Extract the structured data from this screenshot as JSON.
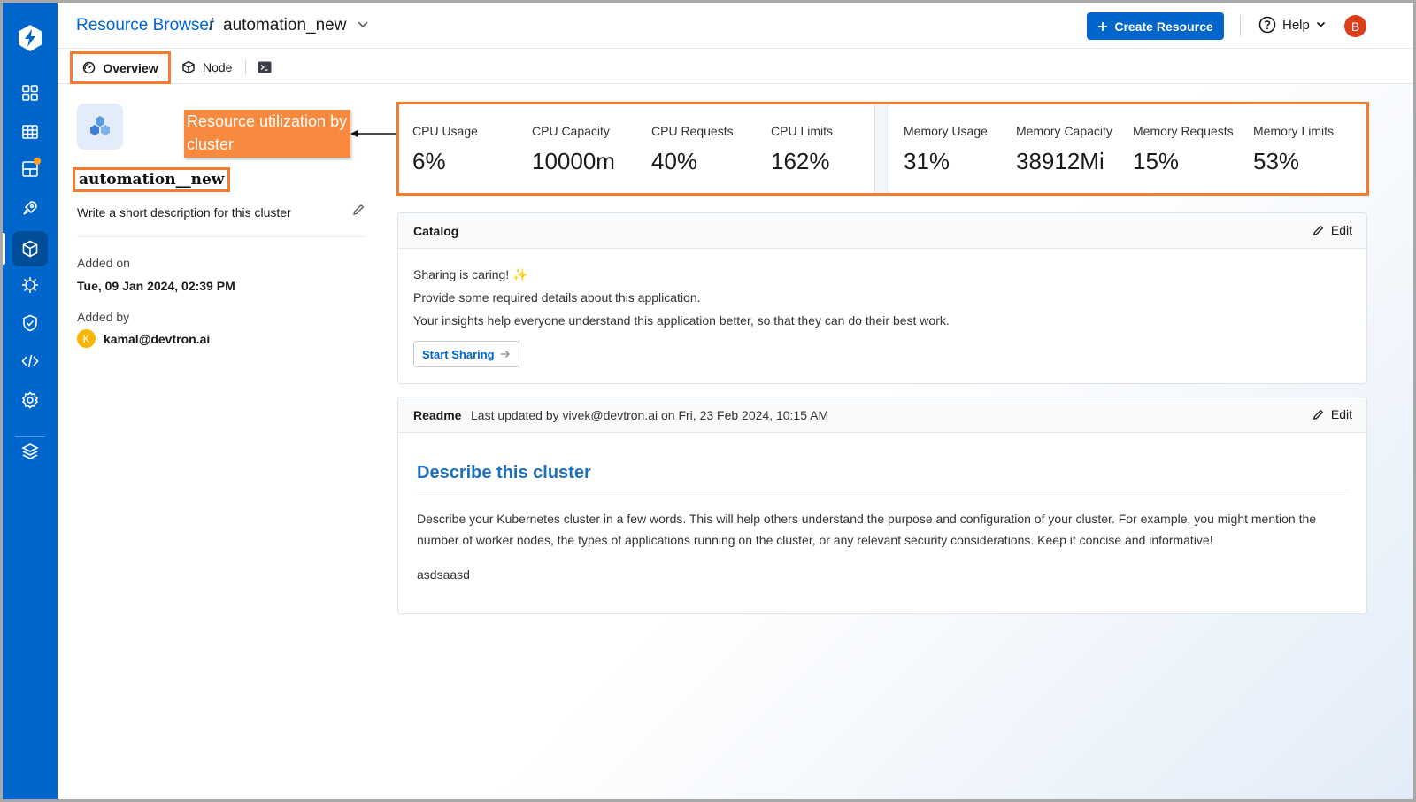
{
  "header": {
    "breadcrumb_link": "Resource Browser",
    "breadcrumb_sep": "/",
    "current": "automation_new",
    "create_button": "Create Resource",
    "help": "Help",
    "user_initial": "B"
  },
  "tabs": {
    "overview": "Overview",
    "node": "Node"
  },
  "cluster": {
    "annotation": "Resource utilization by cluster",
    "name": "automation__new",
    "description": "Write a short description for this cluster",
    "added_on_label": "Added on",
    "added_on": "Tue, 09 Jan 2024, 02:39 PM",
    "added_by_label": "Added by",
    "added_by": "kamal@devtron.ai",
    "added_by_initial": "K"
  },
  "metrics": {
    "cpu": [
      {
        "label": "CPU Usage",
        "value": "6%"
      },
      {
        "label": "CPU Capacity",
        "value": "10000m"
      },
      {
        "label": "CPU Requests",
        "value": "40%"
      },
      {
        "label": "CPU Limits",
        "value": "162%"
      }
    ],
    "memory": [
      {
        "label": "Memory Usage",
        "value": "31%"
      },
      {
        "label": "Memory Capacity",
        "value": "38912Mi"
      },
      {
        "label": "Memory Requests",
        "value": "15%"
      },
      {
        "label": "Memory Limits",
        "value": "53%"
      }
    ]
  },
  "catalog": {
    "title": "Catalog",
    "edit": "Edit",
    "line1": "Sharing is caring! ✨",
    "line2": "Provide some required details about this application.",
    "line3": "Your insights help everyone understand this application better, so that they can do their best work.",
    "button": "Start Sharing"
  },
  "readme": {
    "title": "Readme",
    "updated": "Last updated by vivek@devtron.ai on Fri, 23 Feb 2024, 10:15 AM",
    "edit": "Edit",
    "heading": "Describe this cluster",
    "paragraph": "Describe your Kubernetes cluster in a few words. This will help others understand the purpose and configuration of your cluster. For example, you might mention the number of worker nodes, the types of applications running on the cluster, or any relevant security considerations. Keep it concise and informative!",
    "extra": "asdsaasd"
  },
  "colors": {
    "brand": "#0066cc",
    "nav_active": "#004d99",
    "annotation": "#f47c30"
  }
}
